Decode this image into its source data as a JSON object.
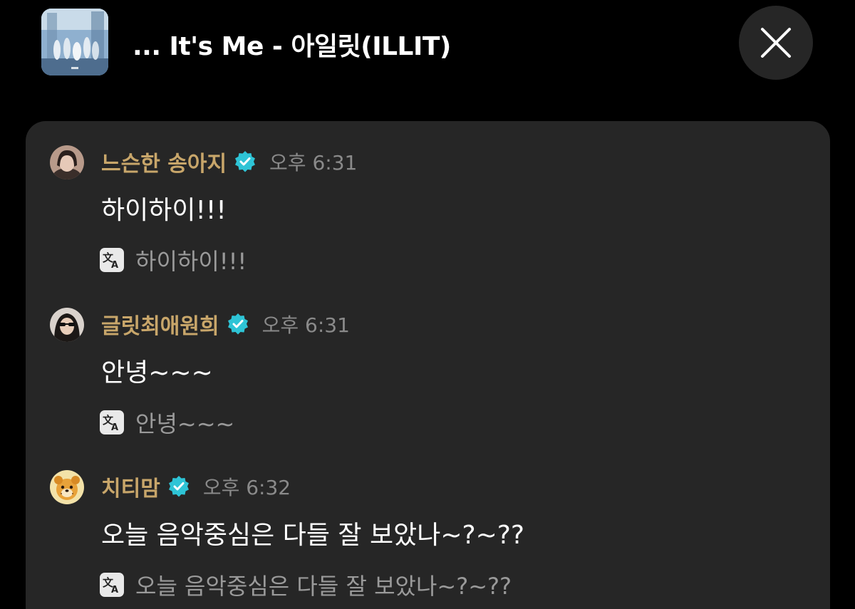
{
  "header": {
    "song_title": "...  It's Me - 아일릿(ILLIT)",
    "album_art_icon": "album-cover",
    "close_icon": "close-icon"
  },
  "messages": [
    {
      "username": "느슨한 송아지",
      "verified": true,
      "timestamp": "오후 6:31",
      "text": "하이하이!!!",
      "translation": "하이하이!!!"
    },
    {
      "username": "글릿최애원희",
      "verified": true,
      "timestamp": "오후 6:31",
      "text": "안녕~~~",
      "translation": "안녕~~~"
    },
    {
      "username": "치티맘",
      "verified": true,
      "timestamp": "오후 6:32",
      "text": "오늘 음악중심은 다들 잘 보았나~?~??",
      "translation": "오늘 음악중심은 다들 잘 보았나~?~??"
    }
  ],
  "colors": {
    "background": "#000000",
    "panel": "#262626",
    "username": "#c8a66a",
    "timestamp": "#8a8a8a",
    "translation_text": "#9a9a9a",
    "verified_badge": "#2ec4d6"
  }
}
